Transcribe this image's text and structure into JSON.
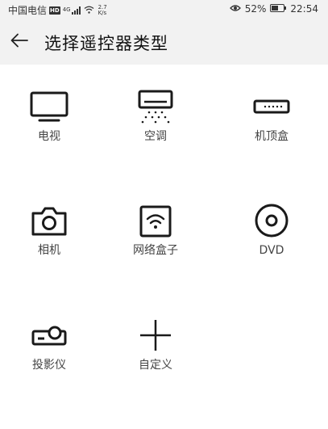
{
  "status_bar": {
    "carrier": "中国电信",
    "hd_badge": "HD",
    "network": "4G",
    "speed_value": "2.7",
    "speed_unit": "K/s",
    "battery": "52%",
    "time": "22:54"
  },
  "header": {
    "title": "选择遥控器类型"
  },
  "devices": [
    {
      "label": "电视",
      "icon": "tv-icon"
    },
    {
      "label": "空调",
      "icon": "air-conditioner-icon"
    },
    {
      "label": "机顶盒",
      "icon": "set-top-box-icon"
    },
    {
      "label": "相机",
      "icon": "camera-icon"
    },
    {
      "label": "网络盒子",
      "icon": "network-box-icon"
    },
    {
      "label": "DVD",
      "icon": "dvd-icon"
    },
    {
      "label": "投影仪",
      "icon": "projector-icon"
    },
    {
      "label": "自定义",
      "icon": "add-custom-icon"
    }
  ]
}
